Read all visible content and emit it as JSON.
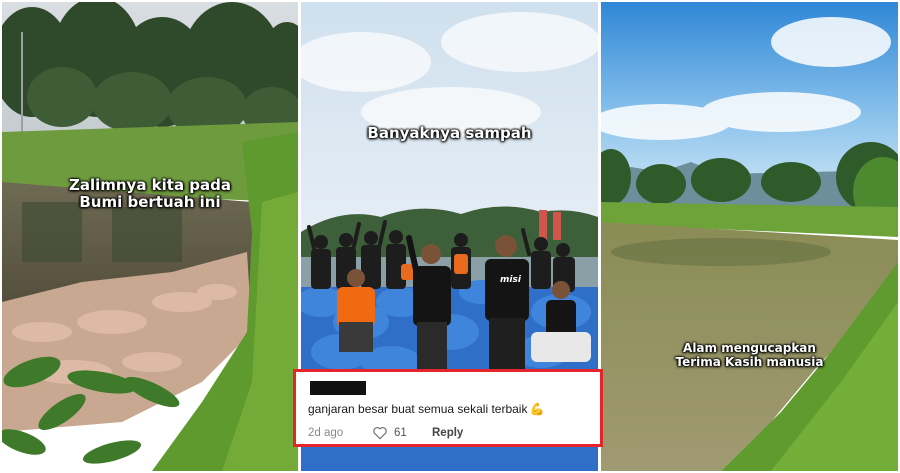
{
  "panels": [
    {
      "caption_lines": [
        "Zalimnya kita pada",
        "Bumi bertuah ini"
      ]
    },
    {
      "caption_lines": [
        "Banyaknya sampah"
      ],
      "shirt_text": "misi"
    },
    {
      "caption_lines": [
        "Alam mengucapkan",
        "Terima Kasih manusia"
      ]
    }
  ],
  "comment": {
    "text": "ganjaran besar buat semua sekali terbaik",
    "emoji": "💪",
    "time": "2d ago",
    "likes": "61",
    "reply_label": "Reply"
  },
  "colors": {
    "highlight_border": "#e5252c",
    "caption_text": "#ffffff"
  }
}
